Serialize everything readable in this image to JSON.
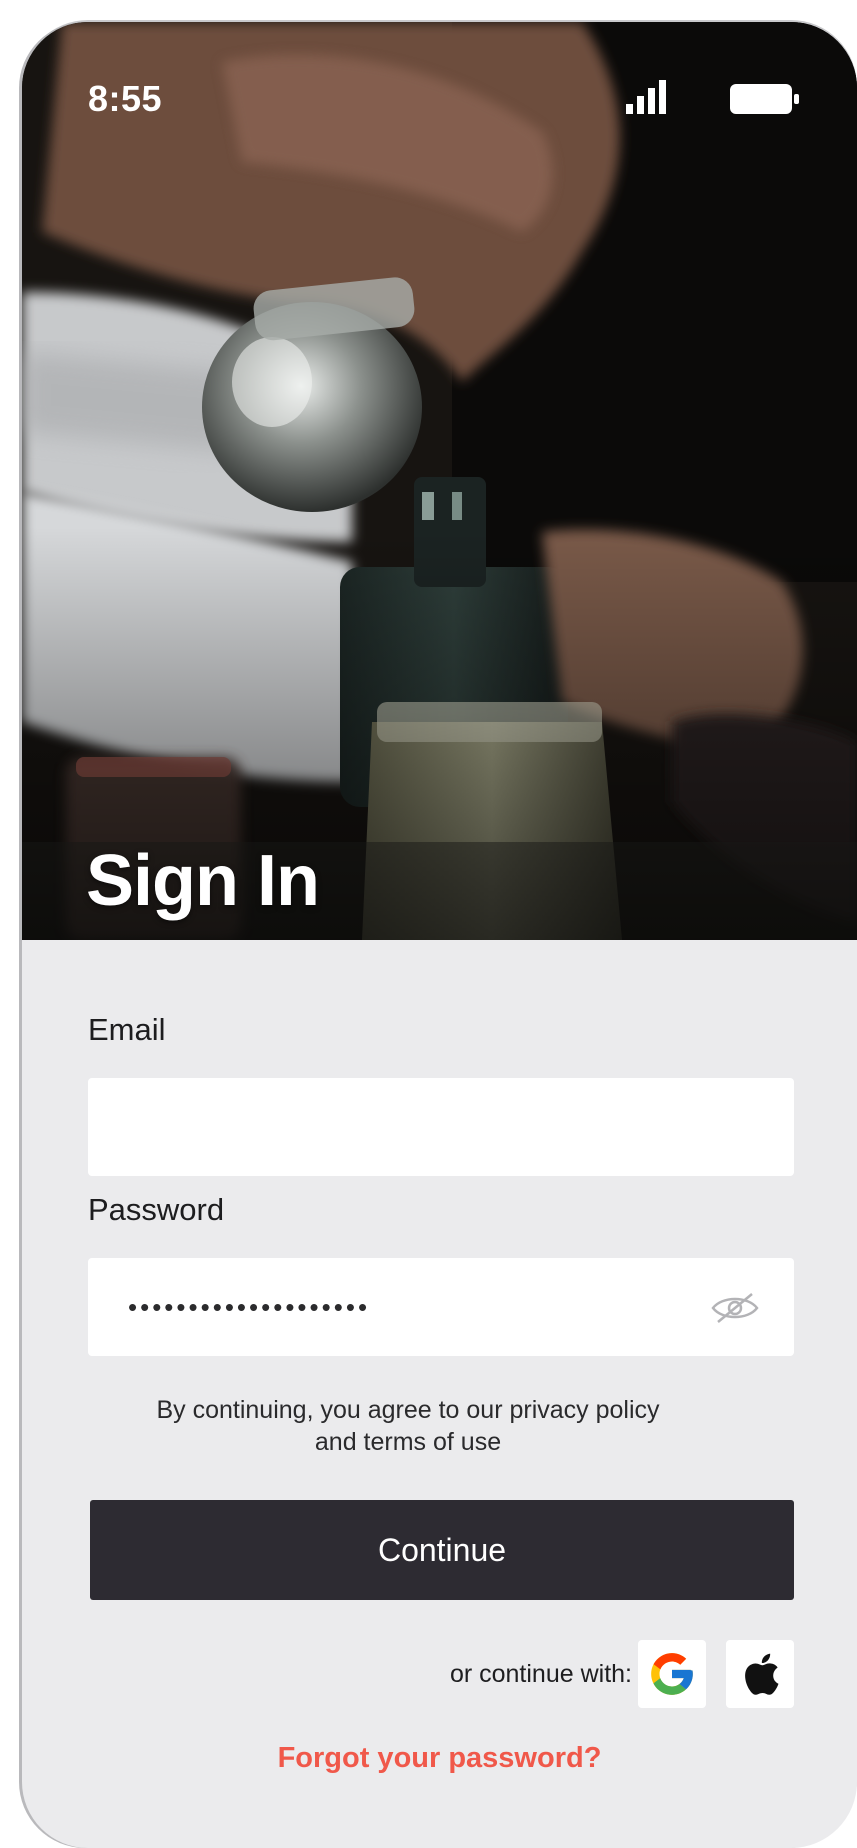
{
  "status_bar": {
    "time": "8:55",
    "signal_icon": "cellular-signal-icon",
    "battery_icon": "battery-icon"
  },
  "hero": {
    "title": "Sign In",
    "image": "photo of hands pouring liquid from a glass flask into a dark bottle"
  },
  "form": {
    "email_label": "Email",
    "email_value": "",
    "password_label": "Password",
    "password_value": "••••••••••••••••••••",
    "password_toggle_icon": "eye-off-icon",
    "terms_line1": "By continuing, you agree to our privacy policy",
    "terms_line2": "and terms of use",
    "continue_label": "Continue",
    "or_continue_with": "or continue with:",
    "social_providers": [
      "google-icon",
      "apple-icon"
    ],
    "forgot_password": "Forgot your password?"
  },
  "colors": {
    "background": "#ebebed",
    "button": "#2d2b32",
    "link": "#f0584a",
    "field": "#ffffff"
  }
}
